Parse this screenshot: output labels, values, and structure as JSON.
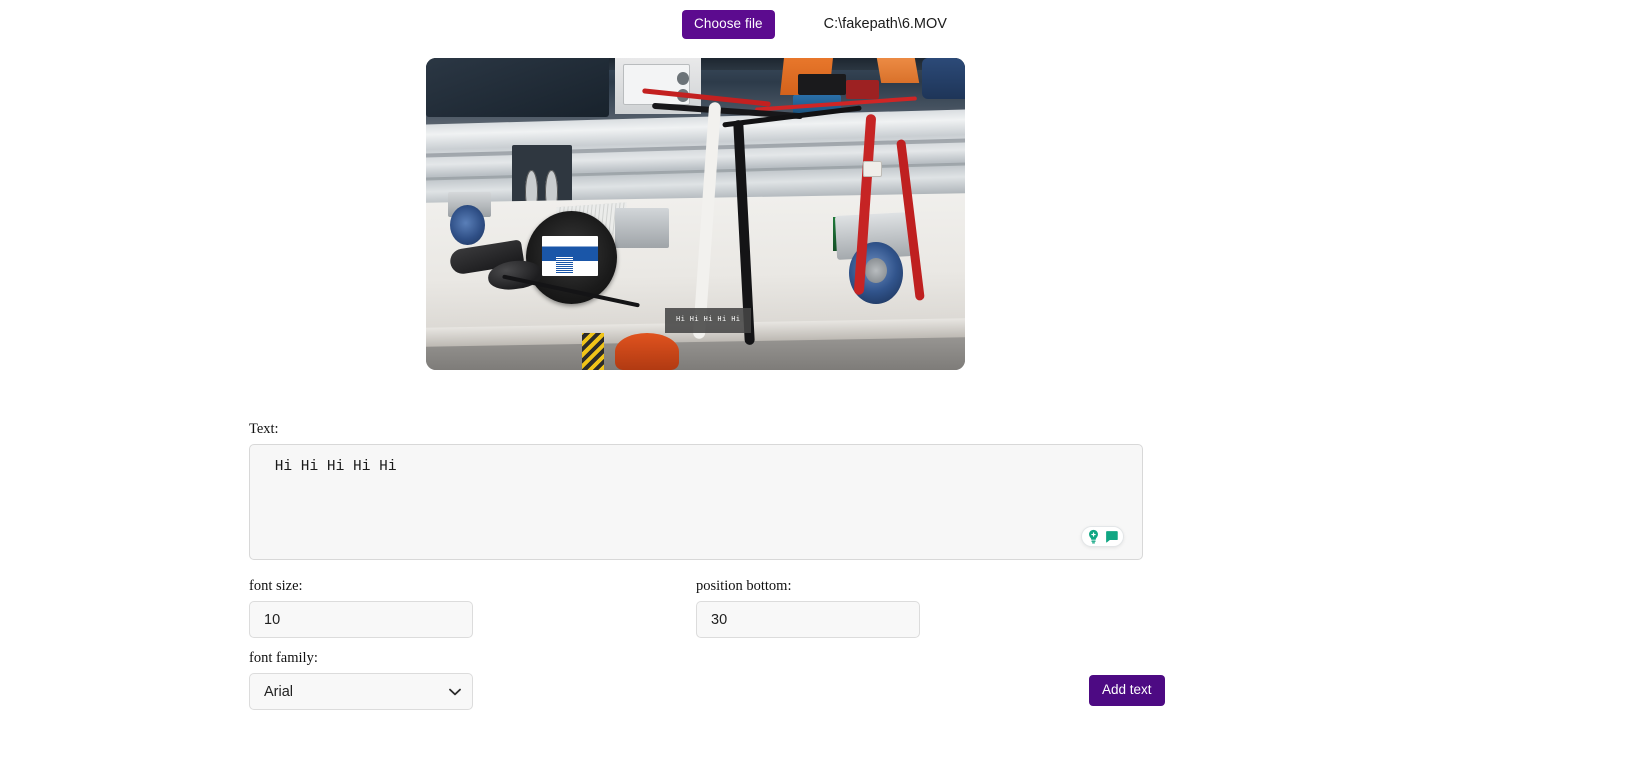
{
  "file_picker": {
    "button_label": "Choose file",
    "file_name": "C:\\fakepath\\6.MOV"
  },
  "video_preview": {
    "overlay_text": "Hi Hi Hi Hi Hi",
    "scene_description": "lab workbench with aluminum extrusion rail, casters, wiring harness, remote control and mouse"
  },
  "form": {
    "text_label": "Text:",
    "text_value": " Hi Hi Hi Hi Hi",
    "text_placeholder": "",
    "font_size_label": "font size:",
    "font_size_value": "10",
    "font_size_placeholder": "",
    "position_bottom_label": "position bottom:",
    "position_bottom_value": "30",
    "position_bottom_placeholder": "",
    "font_family_label": "font family:",
    "font_family_value": "Arial",
    "font_family_options": [
      "Arial"
    ],
    "submit_label": "Add text"
  },
  "assistant_widget": {
    "bulb_icon": "lightbulb-plus-icon",
    "chat_icon": "speech-bubble-icon",
    "accent_color": "#11a683"
  },
  "colors": {
    "button_purple": "#5c0b8f",
    "submit_purple": "#4d0a83",
    "input_bg": "#f8f8f8",
    "input_border": "#dcdcdc",
    "overlay_bg": "rgba(70,70,70,0.88)",
    "page_bg": "#ffffff"
  }
}
